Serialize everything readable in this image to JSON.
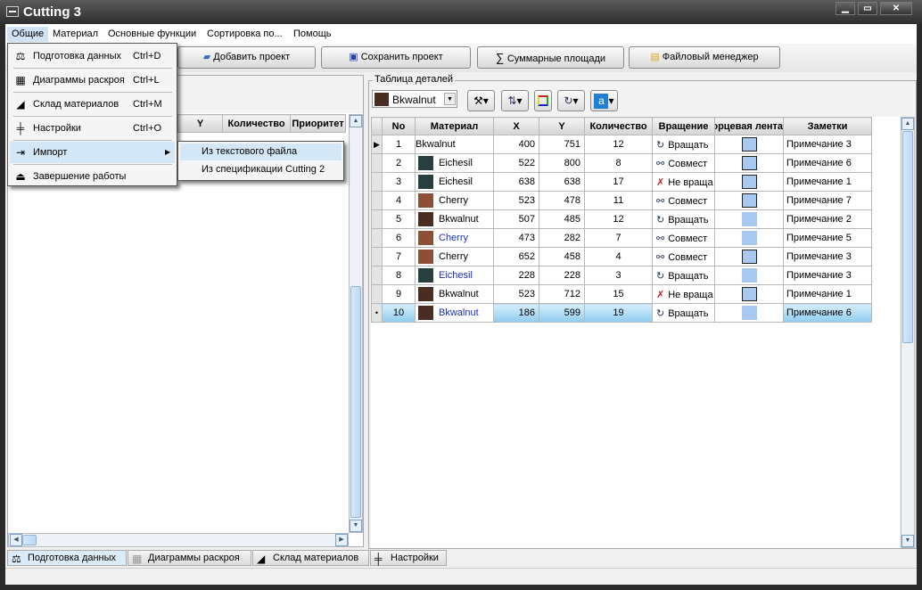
{
  "window": {
    "title": "Cutting 3",
    "minimize": "▁",
    "maximize": "▭",
    "close": "✕"
  },
  "menubar": [
    "Общие",
    "Материал",
    "Основные функции",
    "Сортировка по...",
    "Помощь"
  ],
  "toolbar": {
    "add_project": "Добавить проект",
    "save_project": "Сохранить проект",
    "sum_areas": "Суммарные площади",
    "file_manager": "Файловый менеджер"
  },
  "general_menu": [
    {
      "label": "Подготовка данных",
      "shortcut": "Ctrl+D",
      "icon": "data-prep-icon"
    },
    {
      "label": "Диаграммы раскроя",
      "shortcut": "Ctrl+L",
      "icon": "cutting-diagram-icon"
    },
    {
      "label": "Склад материалов",
      "shortcut": "Ctrl+M",
      "icon": "material-stock-icon"
    },
    {
      "label": "Настройки",
      "shortcut": "Ctrl+O",
      "icon": "settings-icon"
    },
    {
      "label": "Импорт",
      "shortcut": "",
      "icon": "import-icon"
    },
    {
      "label": "Завершение работы",
      "shortcut": "",
      "icon": "exit-icon"
    }
  ],
  "import_submenu": [
    "Из текстового файла",
    "Из спецификации Cutting 2"
  ],
  "left_grid": {
    "columns": [
      "Y",
      "Количество",
      "Приоритет"
    ]
  },
  "details": {
    "group_title": "Таблица деталей",
    "material_select": "Bkwalnut",
    "columns": [
      "No",
      "Материал",
      "X",
      "Y",
      "Количество",
      "Вращение",
      "Торцевая лента",
      "Заметки"
    ],
    "material_colors": {
      "Bkwalnut": "#4a2d22",
      "Eichesil": "#27403f",
      "Cherry": "#8e4f39"
    },
    "rows": [
      {
        "no": "1",
        "material": "Bkwalnut",
        "x": "400",
        "y": "751",
        "qty": "12",
        "rotation": "Вращать",
        "rot_icon": "rotate-icon",
        "edge_border": true,
        "note": "Примечание 3",
        "swatch": false,
        "blue": false
      },
      {
        "no": "2",
        "material": "Eichesil",
        "x": "522",
        "y": "800",
        "qty": "8",
        "rotation": "Совмест",
        "rot_icon": "combined-icon",
        "edge_border": true,
        "note": "Примечание 6",
        "swatch": true,
        "blue": false
      },
      {
        "no": "3",
        "material": "Eichesil",
        "x": "638",
        "y": "638",
        "qty": "17",
        "rotation": "Не враща",
        "rot_icon": "no-rotate-icon",
        "edge_border": true,
        "note": "Примечание 1",
        "swatch": true,
        "blue": false
      },
      {
        "no": "4",
        "material": "Cherry",
        "x": "523",
        "y": "478",
        "qty": "11",
        "rotation": "Совмест",
        "rot_icon": "combined-icon",
        "edge_border": true,
        "note": "Примечание 7",
        "swatch": true,
        "blue": false
      },
      {
        "no": "5",
        "material": "Bkwalnut",
        "x": "507",
        "y": "485",
        "qty": "12",
        "rotation": "Вращать",
        "rot_icon": "rotate-icon",
        "edge_border": false,
        "note": "Примечание 2",
        "swatch": true,
        "blue": false
      },
      {
        "no": "6",
        "material": "Cherry",
        "x": "473",
        "y": "282",
        "qty": "7",
        "rotation": "Совмест",
        "rot_icon": "combined-icon",
        "edge_border": false,
        "note": "Примечание 5",
        "swatch": true,
        "blue": true
      },
      {
        "no": "7",
        "material": "Cherry",
        "x": "652",
        "y": "458",
        "qty": "4",
        "rotation": "Совмест",
        "rot_icon": "combined-icon",
        "edge_border": true,
        "note": "Примечание 3",
        "swatch": true,
        "blue": false
      },
      {
        "no": "8",
        "material": "Eichesil",
        "x": "228",
        "y": "228",
        "qty": "3",
        "rotation": "Вращать",
        "rot_icon": "rotate-icon",
        "edge_border": false,
        "note": "Примечание 3",
        "swatch": true,
        "blue": true
      },
      {
        "no": "9",
        "material": "Bkwalnut",
        "x": "523",
        "y": "712",
        "qty": "15",
        "rotation": "Не враща",
        "rot_icon": "no-rotate-icon",
        "edge_border": true,
        "note": "Примечание 1",
        "swatch": true,
        "blue": false
      },
      {
        "no": "10",
        "material": "Bkwalnut",
        "x": "186",
        "y": "599",
        "qty": "19",
        "rotation": "Вращать",
        "rot_icon": "rotate-icon",
        "edge_border": false,
        "note": "Примечание 6",
        "swatch": true,
        "blue": true
      }
    ]
  },
  "bottom_tabs": [
    "Подготовка данных",
    "Диаграммы раскроя",
    "Склад материалов",
    "Настройки"
  ]
}
